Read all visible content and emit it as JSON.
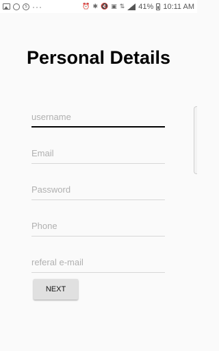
{
  "status_bar": {
    "icons_left": [
      "image-icon",
      "whatsapp-icon",
      "skype-icon"
    ],
    "dots": "···",
    "battery_percent": "41%",
    "time": "10:11 AM"
  },
  "form": {
    "title": "Personal Details",
    "fields": [
      {
        "placeholder": "username",
        "value": ""
      },
      {
        "placeholder": "Email",
        "value": ""
      },
      {
        "placeholder": "Password",
        "value": ""
      },
      {
        "placeholder": "Phone",
        "value": ""
      },
      {
        "placeholder": "referal e-mail",
        "value": ""
      }
    ],
    "next_label": "NEXT"
  }
}
